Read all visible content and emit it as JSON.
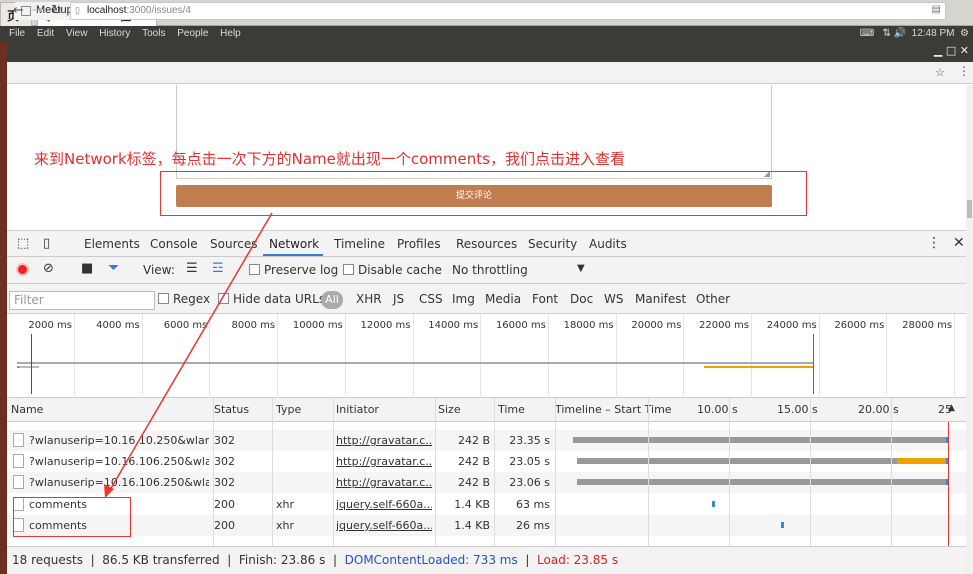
{
  "vm_tabs": [
    {
      "label": "页"
    },
    {
      "label": "Ubuntu 64 位"
    }
  ],
  "panel": {
    "menus": [
      "File",
      "Edit",
      "View",
      "History",
      "Tools",
      "People",
      "Help"
    ],
    "time": "12:48 PM"
  },
  "browser": {
    "tab_title": "Meetup",
    "url_host": "localhost",
    "url_path": ":3000/issues/4"
  },
  "page": {
    "submit_label": "提交评论",
    "annotation": "来到Network标签，每点击一次下方的Name就出现一个comments，我们点击进入查看"
  },
  "devtools": {
    "tabs": [
      "Elements",
      "Console",
      "Sources",
      "Network",
      "Timeline",
      "Profiles",
      "Resources",
      "Security",
      "Audits"
    ],
    "view_label": "View:",
    "preserve_log": "Preserve log",
    "disable_cache": "Disable cache",
    "throttle": "No throttling",
    "filter_placeholder": "Filter",
    "regex": "Regex",
    "hide_data_urls": "Hide data URLs",
    "types": [
      "All",
      "XHR",
      "JS",
      "CSS",
      "Img",
      "Media",
      "Font",
      "Doc",
      "WS",
      "Manifest",
      "Other"
    ],
    "overview_ticks": [
      "2000 ms",
      "4000 ms",
      "6000 ms",
      "8000 ms",
      "10000 ms",
      "12000 ms",
      "14000 ms",
      "16000 ms",
      "18000 ms",
      "20000 ms",
      "22000 ms",
      "24000 ms",
      "26000 ms",
      "28000 ms"
    ],
    "columns": {
      "name": "Name",
      "status": "Status",
      "type": "Type",
      "initiator": "Initiator",
      "size": "Size",
      "time": "Time",
      "timeline": "Timeline – Start Time"
    },
    "timeline_ticks": [
      "10.00 s",
      "15.00 s",
      "20.00 s",
      "25"
    ],
    "rows": [
      {
        "name": "?wlanuserip=10.16.10.250&wlan...",
        "status": "302",
        "type": "",
        "initiator": "http://gravatar.c...",
        "size": "242 B",
        "time": "23.35 s"
      },
      {
        "name": "?wlanuserip=10.16.106.250&wlan...",
        "status": "302",
        "type": "",
        "initiator": "http://gravatar.c...",
        "size": "242 B",
        "time": "23.05 s"
      },
      {
        "name": "?wlanuserip=10.16.106.250&wlan...",
        "status": "302",
        "type": "",
        "initiator": "http://gravatar.c...",
        "size": "242 B",
        "time": "23.06 s"
      },
      {
        "name": "comments",
        "status": "200",
        "type": "xhr",
        "initiator": "jquery.self-660a...",
        "size": "1.4 KB",
        "time": "63 ms"
      },
      {
        "name": "comments",
        "status": "200",
        "type": "xhr",
        "initiator": "jquery.self-660a...",
        "size": "1.4 KB",
        "time": "26 ms"
      }
    ],
    "status": {
      "requests": "18 requests",
      "transferred": "86.5 KB transferred",
      "finish": "Finish: 23.86 s",
      "dcl": "DOMContentLoaded: 733 ms",
      "load": "Load: 23.85 s"
    }
  }
}
